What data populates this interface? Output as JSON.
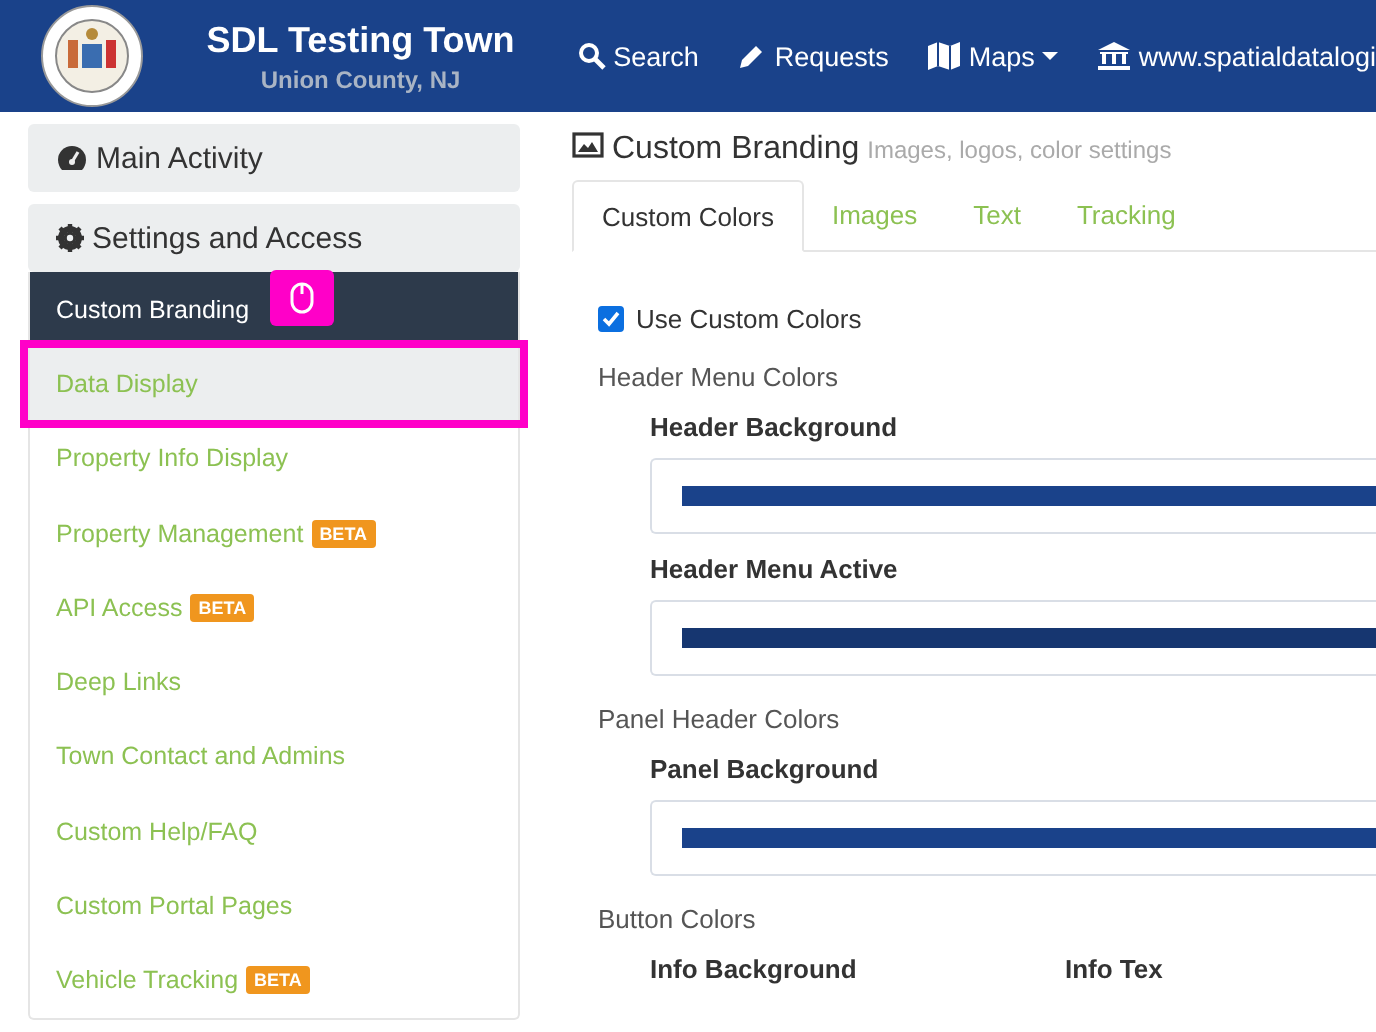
{
  "header": {
    "title": "SDL Testing Town",
    "subtitle": "Union County, NJ",
    "nav": [
      {
        "kind": "search",
        "label": "Search"
      },
      {
        "kind": "pencil",
        "label": "Requests"
      },
      {
        "kind": "map",
        "label": "Maps",
        "dropdown": true
      },
      {
        "kind": "bank",
        "label": "www.spatialdatalogi",
        "dropdown": false
      }
    ]
  },
  "sidebar": {
    "panels": [
      {
        "kind": "gauge",
        "title": "Main Activity"
      },
      {
        "kind": "gear",
        "title": "Settings and Access"
      }
    ],
    "items": [
      {
        "label": "Custom Branding",
        "selected": true,
        "hovered": false,
        "highlighted": false
      },
      {
        "label": "Data Display",
        "selected": false,
        "hovered": true,
        "highlighted": true
      },
      {
        "label": "Property Info Display",
        "selected": false,
        "hovered": false,
        "highlighted": false
      },
      {
        "label": "Property Management",
        "badge": "BETA",
        "selected": false,
        "hovered": false,
        "highlighted": false
      },
      {
        "label": "API Access",
        "badge": "BETA",
        "selected": false,
        "hovered": false,
        "highlighted": false
      },
      {
        "label": "Deep Links",
        "selected": false,
        "hovered": false,
        "highlighted": false
      },
      {
        "label": "Town Contact and Admins",
        "selected": false,
        "hovered": false,
        "highlighted": false
      },
      {
        "label": "Custom Help/FAQ",
        "selected": false,
        "hovered": false,
        "highlighted": false
      },
      {
        "label": "Custom Portal Pages",
        "selected": false,
        "hovered": false,
        "highlighted": false
      },
      {
        "label": "Vehicle Tracking",
        "badge": "BETA",
        "selected": false,
        "hovered": false,
        "highlighted": false
      }
    ]
  },
  "main": {
    "title": "Custom Branding",
    "subtitle": "Images, logos, color settings",
    "tabs": [
      {
        "label": "Custom Colors",
        "selected": true
      },
      {
        "label": "Images",
        "selected": false
      },
      {
        "label": "Text",
        "selected": false
      },
      {
        "label": "Tracking",
        "selected": false
      }
    ],
    "use_custom_colors": {
      "label": "Use Custom Colors",
      "checked": true
    },
    "groups": [
      {
        "title": "Header Menu Colors",
        "fields": [
          {
            "label": "Header Background",
            "color": "#1a428a"
          },
          {
            "label": "Header Menu Active",
            "color": "#163670"
          }
        ]
      },
      {
        "title": "Panel Header Colors",
        "fields": [
          {
            "label": "Panel Background",
            "color": "#1a428a"
          }
        ]
      },
      {
        "title": "Button Colors",
        "pair": [
          {
            "label": "Info Background"
          },
          {
            "label": "Info Tex"
          }
        ]
      }
    ]
  }
}
